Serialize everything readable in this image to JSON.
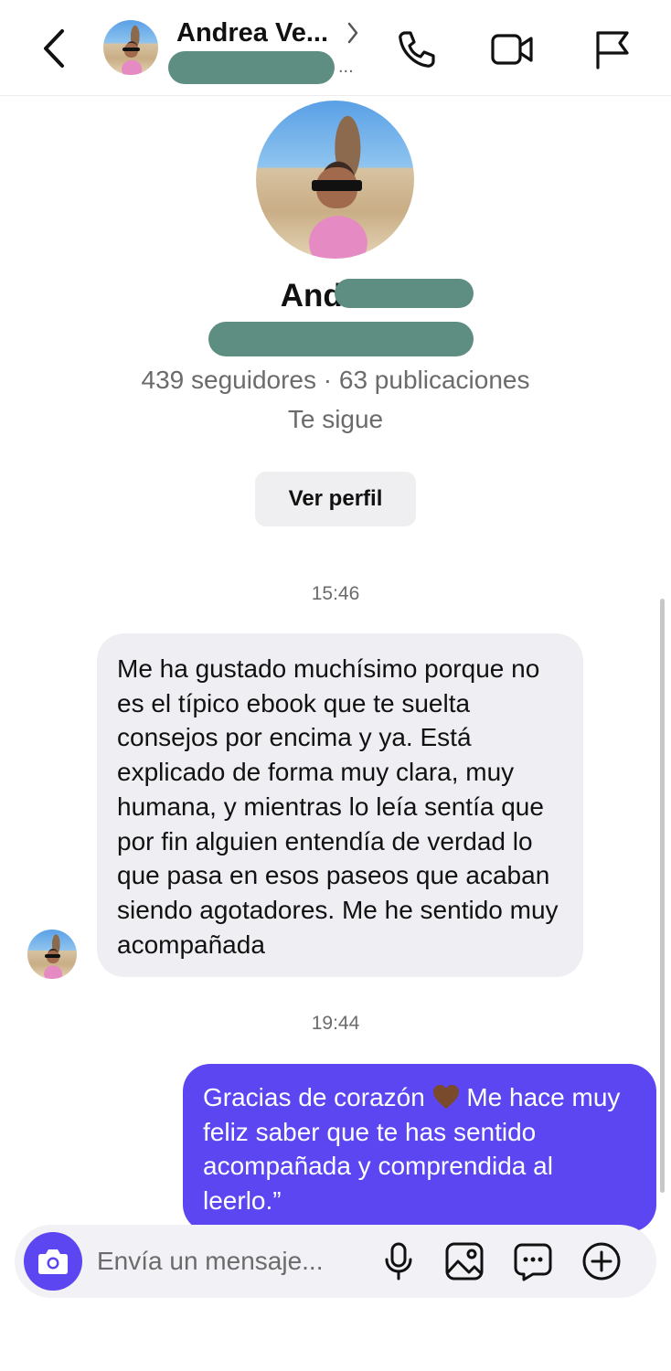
{
  "header": {
    "name": "Andrea Ve...",
    "ellipsis": "..."
  },
  "profile": {
    "name": "Andrea",
    "stats": "439 seguidores · 63 publicaciones",
    "follows_status": "Te sigue",
    "view_profile_label": "Ver perfil"
  },
  "conversation": {
    "timestamp_1": "15:46",
    "incoming_message": "Me ha gustado muchísimo porque no es el típico ebook que te suelta consejos por encima y ya. Está explicado de forma muy clara, muy humana, y mientras lo leía sentía que por fin alguien entendía de verdad lo que pasa en esos paseos que acaban siendo agotadores. Me he sentido muy acompañada",
    "timestamp_2": "19:44",
    "outgoing_message_part1": "Gracias de corazón",
    "outgoing_message_part2": " Me hace muy feliz saber que te has sentido acompañada y comprendida al leerlo.”"
  },
  "composer": {
    "placeholder": "Envía un mensaje..."
  },
  "colors": {
    "accent": "#5b46f2",
    "incoming_bubble": "#efeff3",
    "redaction": "#5e8d81"
  },
  "icons": {
    "back": "chevron-left-icon",
    "call": "phone-icon",
    "video": "video-camera-icon",
    "flag": "flag-icon",
    "camera": "camera-icon",
    "mic": "microphone-icon",
    "gallery": "image-icon",
    "sticker": "sticker-chat-icon",
    "add": "plus-circle-icon",
    "heart": "brown-heart-emoji"
  }
}
